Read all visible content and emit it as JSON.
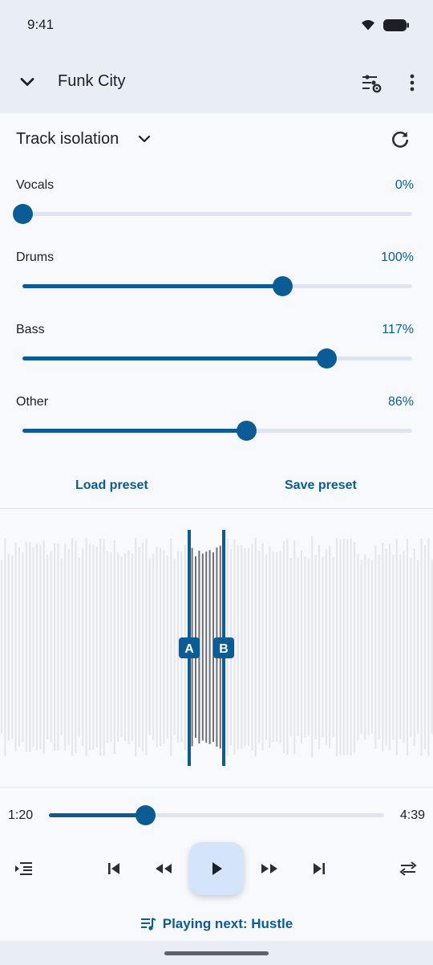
{
  "status": {
    "time": "9:41"
  },
  "appbar": {
    "title": "Funk City"
  },
  "isolation": {
    "title": "Track isolation",
    "sliders": [
      {
        "name": "Vocals",
        "percent_label": "0%",
        "value": 0
      },
      {
        "name": "Drums",
        "percent_label": "100%",
        "value": 100
      },
      {
        "name": "Bass",
        "percent_label": "117%",
        "value": 117
      },
      {
        "name": "Other",
        "percent_label": "86%",
        "value": 86
      }
    ],
    "slider_max": 150,
    "load_preset": "Load preset",
    "save_preset": "Save preset"
  },
  "loop": {
    "marker_a": "A",
    "marker_b": "B"
  },
  "player": {
    "current_time": "1:20",
    "duration": "4:39",
    "progress_fraction": 0.287,
    "playing_next": "Playing next: Hustle"
  },
  "colors": {
    "accent": "#0b5c94",
    "play_button_bg": "#d4e4fb",
    "background": "#e9eef5",
    "panel": "#f8f9fc"
  },
  "icons": {
    "back": "chevron-down-icon",
    "tune": "tune-settings-icon",
    "more": "more-vert-icon",
    "reset": "refresh-icon",
    "queue": "playlist-icon"
  }
}
